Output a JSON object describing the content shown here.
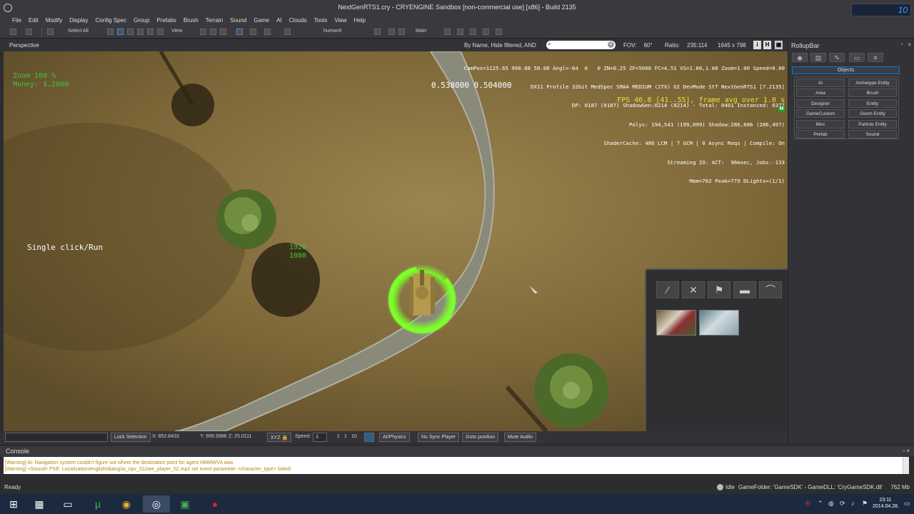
{
  "window": {
    "title": "NextGenRTS1.cry - CRYENGINE Sandbox [non-commercial use] [x86] - Build 2135"
  },
  "menu": [
    "File",
    "Edit",
    "Modify",
    "Display",
    "Config Spec",
    "Group",
    "Prefabs",
    "Brush",
    "Terrain",
    "Sound",
    "Game",
    "AI",
    "Clouds",
    "Tools",
    "View",
    "Help"
  ],
  "toolbar": {
    "select_all": "Select All",
    "view": "View",
    "layer": "human9",
    "main": "Main"
  },
  "viewport_header": {
    "label": "Perspective",
    "filter": "By Name, Hide filtered, AND",
    "search_placeholder": "",
    "fov_label": "FOV:",
    "fov_value": "60°",
    "ratio_label": "Ratio:",
    "ratio_value": "235:114",
    "resolution": "1645 x 798",
    "btn_i": "i",
    "btn_h": "H"
  },
  "hud": {
    "zoom": "Zoom 100 %",
    "money": "Money: $.2000",
    "coords": "0.538000    0.504000",
    "stats": [
      "CamPos=1125.65 990.88 58.00 Angl=-64  0   0 ZN=0.25 ZF=5000 FC=4.51 VS=1.00,1.00 Zoom=1.00 Speed=0.00",
      "DX11 Profile 32bit MedSpec SMAA MEDIUM (2TX) GI DevMode StT NextGenRTS1 [7.2135]",
      "DP: 0187 (0187) ShadowGen:0214 (0214) - Total: 0401 Instanced: 0377",
      "Polys: 194,541 (199,099) Shadow:286,606 (286,497)",
      "ShaderCache: 486 LCM | 7 GCM | 0 Async Reqs | Compile: On",
      "Streaming IO: ACT:  96msec, Jobs:-133",
      "Mem=762 Peak=779 DLights=(1/1)"
    ],
    "fps": "FPS 46.8 [41..55], frame avg over 1.0 s",
    "m_badge": "M",
    "message": "Single click/Run",
    "screen_w": "1920",
    "screen_h": "1080"
  },
  "build_panel": {
    "tools": [
      "⁄",
      "✕",
      "⚑",
      "▬",
      "⌒"
    ]
  },
  "bottom_bar": {
    "lock_selection": "Lock Selection",
    "x": "X: 852.8433",
    "y": "Y: 999.3988",
    "z": "Z: 25.0111",
    "xyz": "XYZ",
    "speed_label": "Speed:",
    "speed_value": "3",
    "speed_opts": [
      "1",
      "1",
      "10"
    ],
    "ai_physics": "AI/Physics",
    "no_sync": "No Sync Player",
    "goto": "Goto position",
    "mute": "Mute Audio"
  },
  "rollup": {
    "title": "RollupBar",
    "objects": "Objects",
    "buttons": [
      "AI",
      "Archetype Entity",
      "Area",
      "Brush",
      "Designer",
      "Entity",
      "GameCustom",
      "Geom Entity",
      "Misc",
      "Particle Entity",
      "Prefab",
      "Sound"
    ]
  },
  "console": {
    "label": "Console",
    "lines": [
      "[Warning] AI: Navigation system couldn't figure out where the destination point for agent HMMWV4 was.",
      "[Warning] <Sound> PSE: Localization/english/dialog/ai_npc_01/see_player_02.mp2 set event parameter <character_type> failed!"
    ]
  },
  "status": {
    "ready": "Ready",
    "idle": "Idle",
    "game_folder": "GameFolder: 'GameSDK' - GameDLL: 'CryGameSDK.dll'",
    "mem": "762 Mb"
  },
  "taskbar": {
    "time": "23:11",
    "date": "2014.04.28.",
    "perf_value": "10"
  },
  "colors": {
    "hud_green": "#46c23c",
    "fps_yellow": "#e8e03a",
    "selection_ring": "#7cff2a",
    "terrain": "#7a6536",
    "road": "#8a8a7a"
  }
}
